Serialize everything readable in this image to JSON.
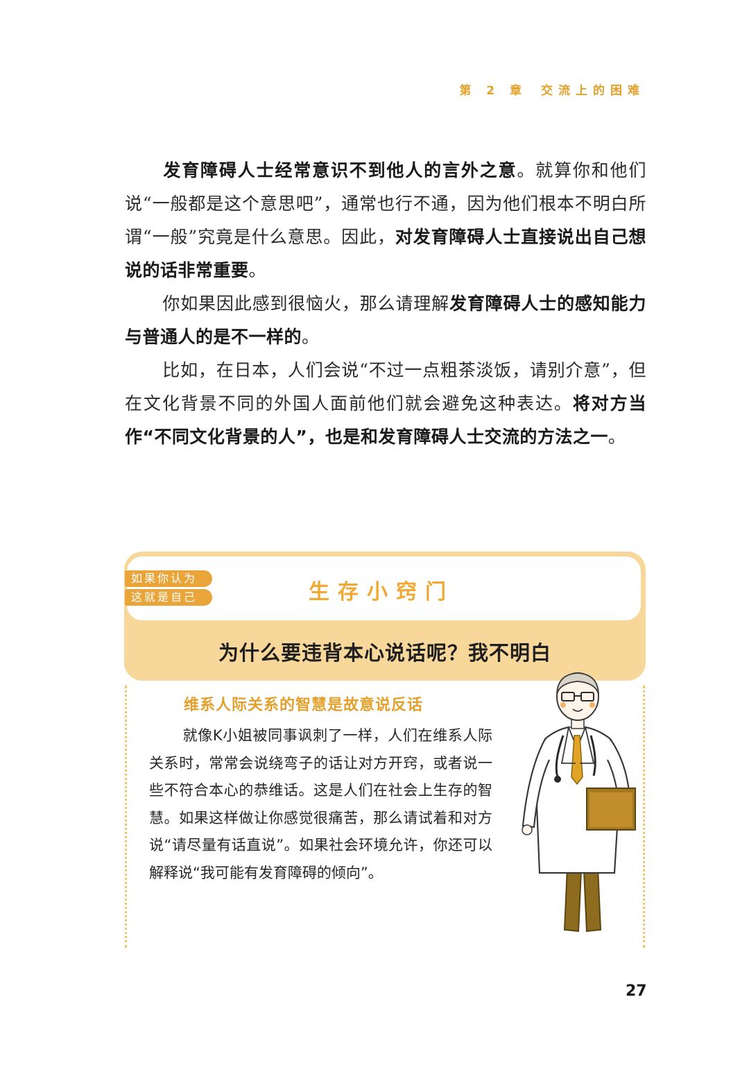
{
  "header": {
    "chapter_number": "第 2 章",
    "chapter_title": "交流上的困难"
  },
  "body": {
    "p1": {
      "bold1": "发育障碍人士经常意识不到他人的言外之意",
      "text1": "。就算你和他们说“一般都是这个意思吧”，通常也行不通，因为他们根本不明白所谓“一般”究竟是什么意思。因此，",
      "bold2": "对发育障碍人士直接说出自己想说的话非常重要",
      "text2": "。"
    },
    "p2": {
      "text1": "你如果因此感到很恼火，那么请理解",
      "bold1": "发育障碍人士的感知能力与普通人的是不一样的",
      "text2": "。"
    },
    "p3": {
      "text1": "比如，在日本，人们会说“不过一点粗茶淡饭，请别介意”，但在文化背景不同的外国人面前他们就会避免这种表达。",
      "bold1": "将对方当作“不同文化背景的人”，也是和发育障碍人士交流的方法之一",
      "text2": "。"
    }
  },
  "box": {
    "tag_line1": "如果你认为",
    "tag_line2": "这就是自己",
    "title": "生存小窍门",
    "question": "为什么要违背本心说话呢？我不明白",
    "answer_title": "维系人际关系的智慧是故意说反话",
    "answer_text": "就像K小姐被同事讽刺了一样，人们在维系人际关系时，常常会说绕弯子的话让对方开窍，或者说一些不符合本心的恭维话。这是人们在社会上生存的智慧。如果这样做让你感觉很痛苦，那么请试着和对方说“请尽量有话直说”。如果社会环境允许，你还可以解释说“我可能有发育障碍的倾向”。"
  },
  "page_number": "27",
  "colors": {
    "accent": "#e3a12c",
    "box_fill": "#f8d79a",
    "tag_fill": "#e9a43a",
    "doctor_pants": "#8e6c1f",
    "doctor_tie": "#e0a527"
  },
  "illustration": "doctor-illustration"
}
